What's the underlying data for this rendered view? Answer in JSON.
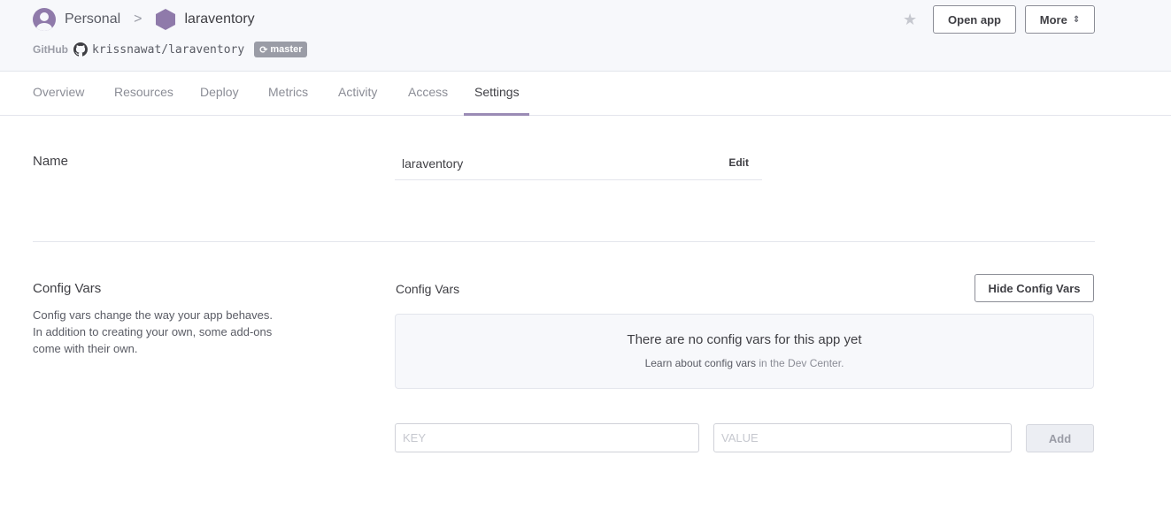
{
  "breadcrumb": {
    "personal_label": "Personal",
    "separator": ">",
    "app_name": "laraventory"
  },
  "repo": {
    "provider_label": "GitHub",
    "name": "krissnawat/laraventory",
    "branch": "master"
  },
  "header_actions": {
    "favorite_icon": "star-icon",
    "open_app_label": "Open app",
    "more_label": "More",
    "more_icon": "up-down-chevron-icon"
  },
  "tabs": [
    {
      "label": "Overview",
      "active": false
    },
    {
      "label": "Resources",
      "active": false
    },
    {
      "label": "Deploy",
      "active": false
    },
    {
      "label": "Metrics",
      "active": false
    },
    {
      "label": "Activity",
      "active": false
    },
    {
      "label": "Access",
      "active": false
    },
    {
      "label": "Settings",
      "active": true
    }
  ],
  "name_section": {
    "label": "Name",
    "value": "laraventory",
    "edit_label": "Edit"
  },
  "config_vars": {
    "title": "Config Vars",
    "description": "Config vars change the way your app behaves. In addition to creating your own, some add-ons come with their own.",
    "heading": "Config Vars",
    "hide_button_label": "Hide Config Vars",
    "empty_title": "There are no config vars for this app yet",
    "learn_link": "Learn about config vars",
    "learn_suffix": "in the Dev Center.",
    "key_placeholder": "KEY",
    "value_placeholder": "VALUE",
    "add_label": "Add"
  },
  "colors": {
    "accent": "#9a8bb5",
    "header_bg": "#f7f8fb",
    "text": "#3f3f44",
    "muted": "#8b8d96"
  }
}
